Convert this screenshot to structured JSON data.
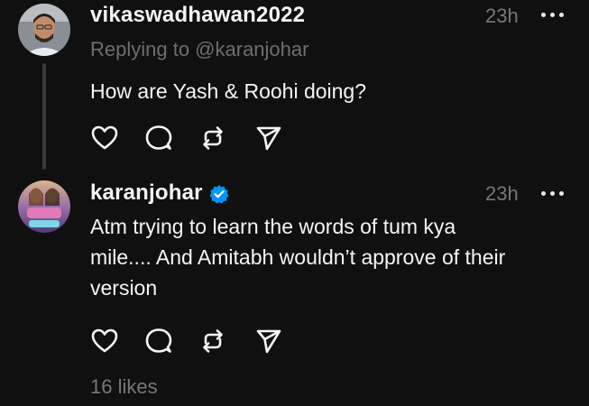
{
  "posts": [
    {
      "username": "vikaswadhawan2022",
      "time": "23h",
      "replying_to": "Replying to @karanjohar",
      "text": "How are Yash & Roohi doing?",
      "verified": false
    },
    {
      "username": "karanjohar",
      "time": "23h",
      "text_lines": [
        "Atm trying to learn the words of tum kya",
        "mile.... And Amitabh wouldn’t approve of their",
        "version"
      ],
      "verified": true,
      "likes": "16 likes"
    }
  ],
  "icons": {
    "more": "more-horizontal-icon",
    "like": "heart-icon",
    "comment": "comment-icon",
    "repost": "repost-icon",
    "share": "send-icon",
    "verified": "verified-badge-icon"
  },
  "colors": {
    "background": "#101010",
    "primary_text": "#f3f5f7",
    "secondary_text": "#777777",
    "verified_blue": "#0095f6"
  }
}
